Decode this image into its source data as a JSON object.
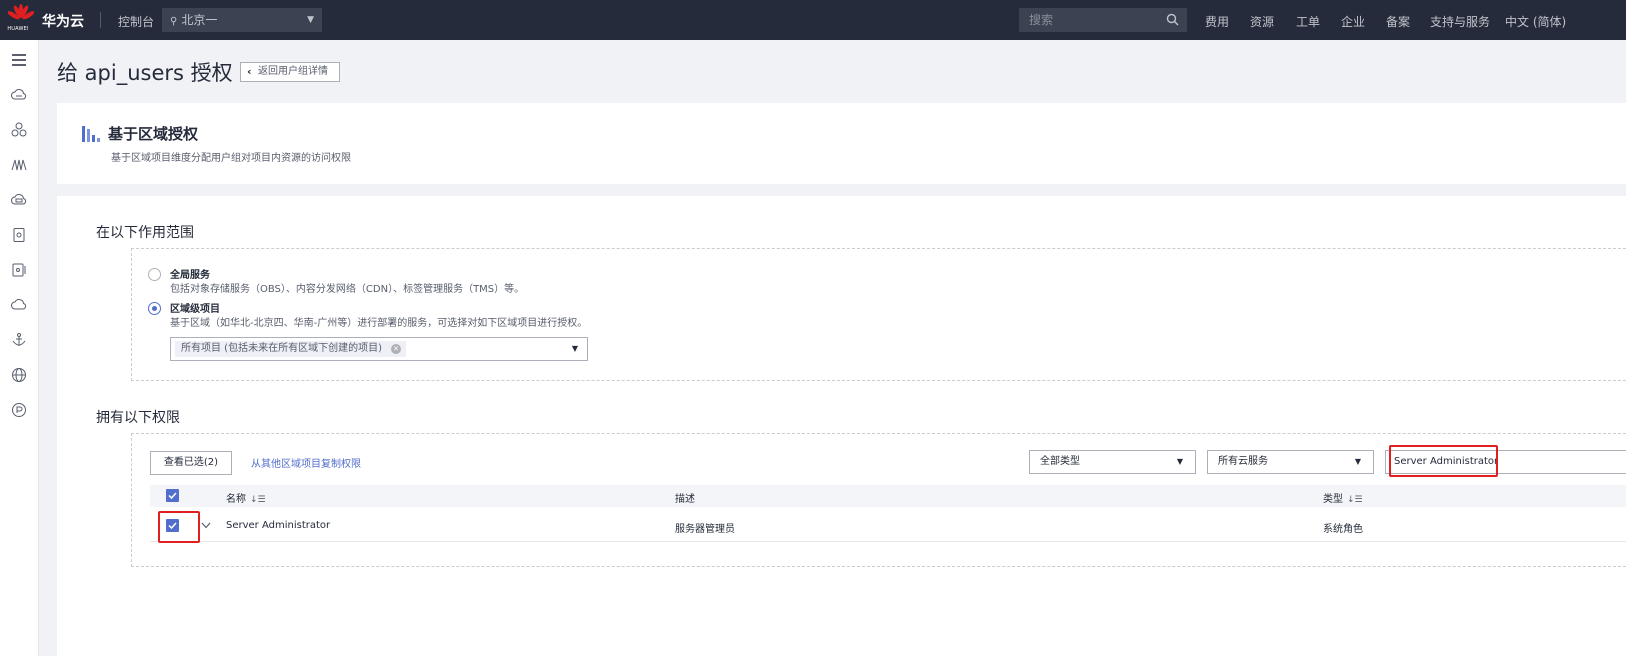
{
  "topbar": {
    "logo_text": "HUAWEI",
    "brand": "华为云",
    "console": "控制台",
    "region": "北京一",
    "search_placeholder": "搜索",
    "nav": [
      "费用",
      "资源",
      "工单",
      "企业",
      "备案",
      "支持与服务",
      "中文 (简体)"
    ]
  },
  "sidebar": {
    "icons": [
      "menu-icon",
      "cloud-server-icon",
      "network-icon",
      "monitor-icon",
      "storage-icon",
      "database-icon",
      "container-icon",
      "cloud-icon",
      "deploy-icon",
      "globe-icon",
      "settings-icon"
    ]
  },
  "page": {
    "title": "给 api_users 授权",
    "back_label": "返回用户组详情"
  },
  "section": {
    "title": "基于区域授权",
    "desc": "基于区域项目维度分配用户组对项目内资源的访问权限"
  },
  "scope": {
    "heading": "在以下作用范围",
    "options": [
      {
        "title": "全局服务",
        "desc": "包括对象存储服务（OBS）、内容分发网络（CDN）、标签管理服务（TMS）等。",
        "selected": false
      },
      {
        "title": "区域级项目",
        "desc": "基于区域（如华北-北京四、华南-广州等）进行部署的服务，可选择对如下区域项目进行授权。",
        "selected": true
      }
    ],
    "project_chip": "所有项目 (包括未来在所有区域下创建的项目)"
  },
  "permissions": {
    "heading": "拥有以下权限",
    "view_selected": "查看已选(2)",
    "copy_link": "从其他区域项目复制权限",
    "type_filter": "全部类型",
    "service_filter": "所有云服务",
    "search_value": "Server Administrator",
    "columns": {
      "name": "名称",
      "desc": "描述",
      "type": "类型"
    },
    "rows": [
      {
        "name": "Server Administrator",
        "desc": "服务器管理员",
        "type": "系统角色",
        "checked": true
      }
    ]
  },
  "colors": {
    "accent": "#526ecc",
    "highlight": "#e02020",
    "topbar": "#252b3a"
  }
}
